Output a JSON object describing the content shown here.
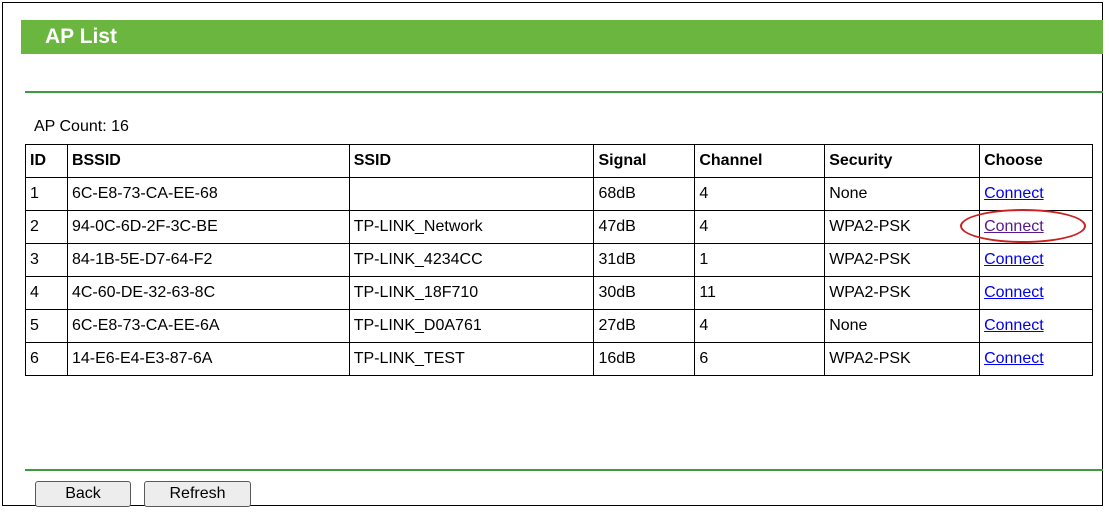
{
  "header": {
    "title": "AP List"
  },
  "ap_count": {
    "label": "AP Count: 16"
  },
  "table": {
    "columns": [
      "ID",
      "BSSID",
      "SSID",
      "Signal",
      "Channel",
      "Security",
      "Choose"
    ],
    "rows": [
      {
        "id": "1",
        "bssid": "6C-E8-73-CA-EE-68",
        "ssid": "",
        "signal": "68dB",
        "channel": "4",
        "security": "None",
        "action": "Connect"
      },
      {
        "id": "2",
        "bssid": "94-0C-6D-2F-3C-BE",
        "ssid": "TP-LINK_Network",
        "signal": "47dB",
        "channel": "4",
        "security": "WPA2-PSK",
        "action": "Connect"
      },
      {
        "id": "3",
        "bssid": "84-1B-5E-D7-64-F2",
        "ssid": "TP-LINK_4234CC",
        "signal": "31dB",
        "channel": "1",
        "security": "WPA2-PSK",
        "action": "Connect"
      },
      {
        "id": "4",
        "bssid": "4C-60-DE-32-63-8C",
        "ssid": "TP-LINK_18F710",
        "signal": "30dB",
        "channel": "11",
        "security": "WPA2-PSK",
        "action": "Connect"
      },
      {
        "id": "5",
        "bssid": "6C-E8-73-CA-EE-6A",
        "ssid": "TP-LINK_D0A761",
        "signal": "27dB",
        "channel": "4",
        "security": "None",
        "action": "Connect"
      },
      {
        "id": "6",
        "bssid": "14-E6-E4-E3-87-6A",
        "ssid": "TP-LINK_TEST",
        "signal": "16dB",
        "channel": "6",
        "security": "WPA2-PSK",
        "action": "Connect"
      }
    ]
  },
  "buttons": {
    "back": "Back",
    "refresh": "Refresh"
  },
  "colors": {
    "title_bar": "#6ab63f",
    "divider": "#3f9a3f",
    "link": "#0000ee",
    "visited_link": "#551a8b",
    "highlight": "#cc1f1f"
  }
}
